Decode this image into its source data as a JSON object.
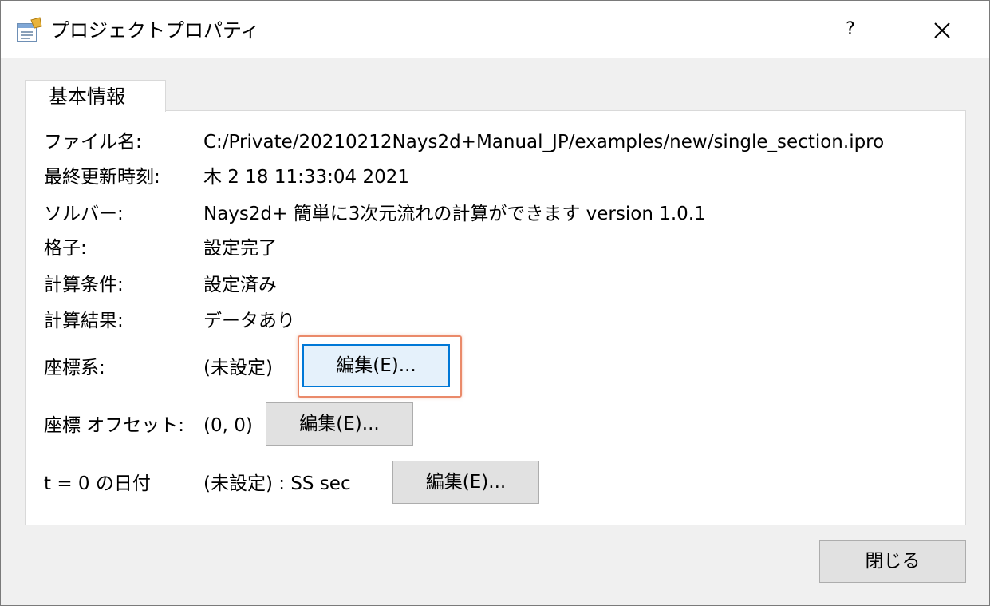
{
  "window": {
    "title": "プロジェクトプロパティ",
    "help_label": "?",
    "icon": "project-properties-icon",
    "close_icon": "close-icon"
  },
  "tabs": [
    {
      "label": "基本情報",
      "selected": true
    }
  ],
  "fields": {
    "file": {
      "label": "ファイル名:",
      "value": "C:/Private/20210212Nays2d+Manual_JP/examples/new/single_section.ipro"
    },
    "modified": {
      "label": "最終更新時刻:",
      "value": "木 2 18 11:33:04 2021"
    },
    "solver": {
      "label": "ソルバー:",
      "value": "Nays2d+ 簡単に3次元流れの計算ができます version 1.0.1"
    },
    "grid": {
      "label": "格子:",
      "value": "設定完了"
    },
    "calc_cond": {
      "label": "計算条件:",
      "value": "設定済み"
    },
    "calc_res": {
      "label": "計算結果:",
      "value": "データあり"
    },
    "coord": {
      "label": "座標系:",
      "value": "(未設定)",
      "button": "編集(E)..."
    },
    "offset": {
      "label": "座標 オフセット:",
      "value": "(0, 0)",
      "button": "編集(E)..."
    },
    "t0": {
      "label": "t = 0 の日付",
      "value": "(未設定) : SS sec",
      "button": "編集(E)..."
    }
  },
  "footer": {
    "close_label": "閉じる"
  },
  "colors": {
    "focus_border": "#0078d7",
    "highlight": "#ea8a6a",
    "button_bg": "#e1e1e1"
  }
}
